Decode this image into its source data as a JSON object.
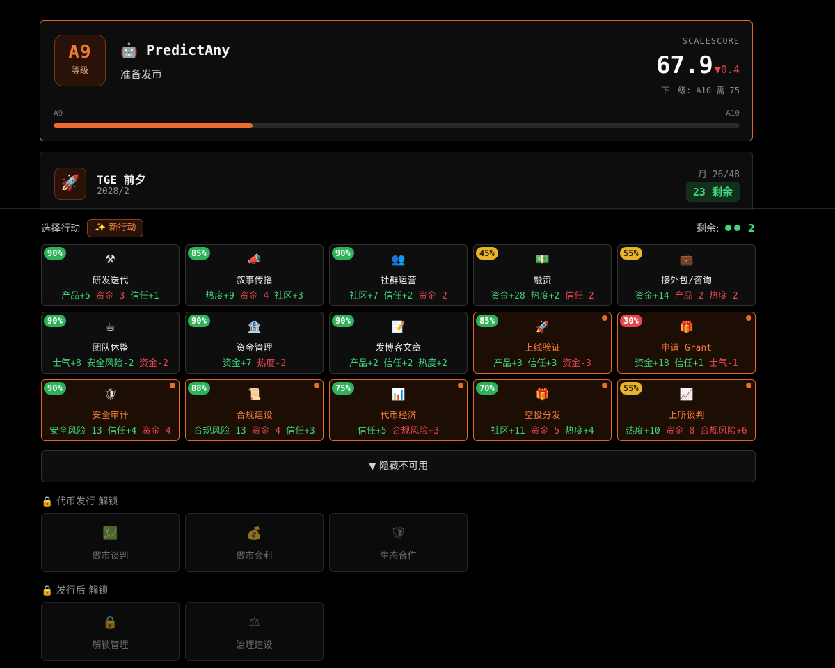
{
  "level": {
    "badge": "A9",
    "badge_label": "等级",
    "project_name": "🤖 PredictAny",
    "status": "准备发币",
    "score_label": "SCALESCORE",
    "score": "67.9",
    "score_delta": "▼0.4",
    "next_level": "下一级: A10 需 75",
    "progress_from": "A9",
    "progress_to": "A10",
    "progress_fraction": 0.29
  },
  "tge": {
    "icon": "rocket-icon",
    "title": "TGE 前夕",
    "date": "2028/2",
    "month": "月 26/48",
    "remaining": "23 剩余"
  },
  "actions_header": {
    "label": "选择行动",
    "new_action": "✨ 新行动",
    "remaining_label": "剩余:",
    "remaining_count": "2"
  },
  "actions": [
    {
      "pct": "90%",
      "tone": "g",
      "icon": "⚒",
      "icon_name": "hammer-icon",
      "title": "研发迭代",
      "hl": false,
      "effects": [
        {
          "t": "产品+5",
          "p": true
        },
        {
          "t": "资金-3",
          "p": false
        },
        {
          "t": "信任+1",
          "p": true
        }
      ]
    },
    {
      "pct": "85%",
      "tone": "g",
      "icon": "📣",
      "icon_name": "megaphone-icon",
      "title": "叙事传播",
      "hl": false,
      "effects": [
        {
          "t": "热度+9",
          "p": true
        },
        {
          "t": "资金-4",
          "p": false
        },
        {
          "t": "社区+3",
          "p": true
        }
      ]
    },
    {
      "pct": "90%",
      "tone": "g",
      "icon": "👥",
      "icon_name": "people-icon",
      "title": "社群运营",
      "hl": false,
      "effects": [
        {
          "t": "社区+7",
          "p": true
        },
        {
          "t": "信任+2",
          "p": true
        },
        {
          "t": "资金-2",
          "p": false
        }
      ]
    },
    {
      "pct": "45%",
      "tone": "y",
      "icon": "💵",
      "icon_name": "money-icon",
      "title": "融资",
      "hl": false,
      "effects": [
        {
          "t": "资金+28",
          "p": true
        },
        {
          "t": "热度+2",
          "p": true
        },
        {
          "t": "信任-2",
          "p": false
        }
      ]
    },
    {
      "pct": "55%",
      "tone": "y",
      "icon": "💼",
      "icon_name": "briefcase-icon",
      "title": "接外包/咨询",
      "hl": false,
      "effects": [
        {
          "t": "资金+14",
          "p": true
        },
        {
          "t": "产品-2",
          "p": false
        },
        {
          "t": "热度-2",
          "p": false
        }
      ]
    },
    {
      "pct": "90%",
      "tone": "g",
      "icon": "☕",
      "icon_name": "coffee-icon",
      "title": "团队休整",
      "hl": false,
      "effects": [
        {
          "t": "士气+8",
          "p": true
        },
        {
          "t": "安全风险-2",
          "p": true
        },
        {
          "t": "资金-2",
          "p": false
        }
      ]
    },
    {
      "pct": "90%",
      "tone": "g",
      "icon": "🏦",
      "icon_name": "bank-icon",
      "title": "资金管理",
      "hl": false,
      "effects": [
        {
          "t": "资金+7",
          "p": true
        },
        {
          "t": "热度-2",
          "p": false
        }
      ]
    },
    {
      "pct": "90%",
      "tone": "g",
      "icon": "📝",
      "icon_name": "memo-icon",
      "title": "发博客文章",
      "hl": false,
      "effects": [
        {
          "t": "产品+2",
          "p": true
        },
        {
          "t": "信任+2",
          "p": true
        },
        {
          "t": "热度+2",
          "p": true
        }
      ]
    },
    {
      "pct": "85%",
      "tone": "g",
      "icon": "🚀",
      "icon_name": "rocket-icon",
      "title": "上线验证",
      "hl": true,
      "effects": [
        {
          "t": "产品+3",
          "p": true
        },
        {
          "t": "信任+3",
          "p": true
        },
        {
          "t": "资金-3",
          "p": false
        }
      ]
    },
    {
      "pct": "30%",
      "tone": "r",
      "icon": "🎁",
      "icon_name": "gift-icon",
      "title": "申请 Grant",
      "hl": true,
      "effects": [
        {
          "t": "资金+18",
          "p": true
        },
        {
          "t": "信任+1",
          "p": true
        },
        {
          "t": "士气-1",
          "p": false
        }
      ]
    },
    {
      "pct": "90%",
      "tone": "g",
      "icon": "🛡",
      "icon_name": "shield-icon",
      "title": "安全审计",
      "hl": true,
      "effects": [
        {
          "t": "安全风险-13",
          "p": true
        },
        {
          "t": "信任+4",
          "p": true
        },
        {
          "t": "资金-4",
          "p": false
        }
      ]
    },
    {
      "pct": "88%",
      "tone": "g",
      "icon": "📜",
      "icon_name": "scroll-icon",
      "title": "合规建设",
      "hl": true,
      "effects": [
        {
          "t": "合规风险-13",
          "p": true
        },
        {
          "t": "资金-4",
          "p": false
        },
        {
          "t": "信任+3",
          "p": true
        }
      ]
    },
    {
      "pct": "75%",
      "tone": "g",
      "icon": "📊",
      "icon_name": "bar-chart-icon",
      "title": "代币经济",
      "hl": true,
      "effects": [
        {
          "t": "信任+5",
          "p": true
        },
        {
          "t": "合规风险+3",
          "p": false
        }
      ]
    },
    {
      "pct": "70%",
      "tone": "g",
      "icon": "🎁",
      "icon_name": "gift-icon",
      "title": "空投分发",
      "hl": true,
      "effects": [
        {
          "t": "社区+11",
          "p": true
        },
        {
          "t": "资金-5",
          "p": false
        },
        {
          "t": "热度+4",
          "p": true
        }
      ]
    },
    {
      "pct": "55%",
      "tone": "y",
      "icon": "📈",
      "icon_name": "chart-up-icon",
      "title": "上所谈判",
      "hl": true,
      "effects": [
        {
          "t": "热度+10",
          "p": true
        },
        {
          "t": "资金-8",
          "p": false
        },
        {
          "t": "合规风险+6",
          "p": false
        }
      ]
    }
  ],
  "hide_button": "▼ 隐藏不可用",
  "locked_sections": [
    {
      "label": "🔒 代币发行 解锁",
      "items": [
        {
          "icon": "💹",
          "icon_name": "chart-yen-icon",
          "title": "做市谈判"
        },
        {
          "icon": "💰",
          "icon_name": "money-bag-icon",
          "title": "做市套利"
        },
        {
          "icon": "🛡",
          "icon_name": "shield-icon",
          "title": "生态合作"
        }
      ]
    },
    {
      "label": "🔒 发行后 解锁",
      "items": [
        {
          "icon": "🔒",
          "icon_name": "lock-icon",
          "title": "解锁管理"
        },
        {
          "icon": "⚖",
          "icon_name": "scales-icon",
          "title": "治理建设"
        }
      ]
    }
  ]
}
